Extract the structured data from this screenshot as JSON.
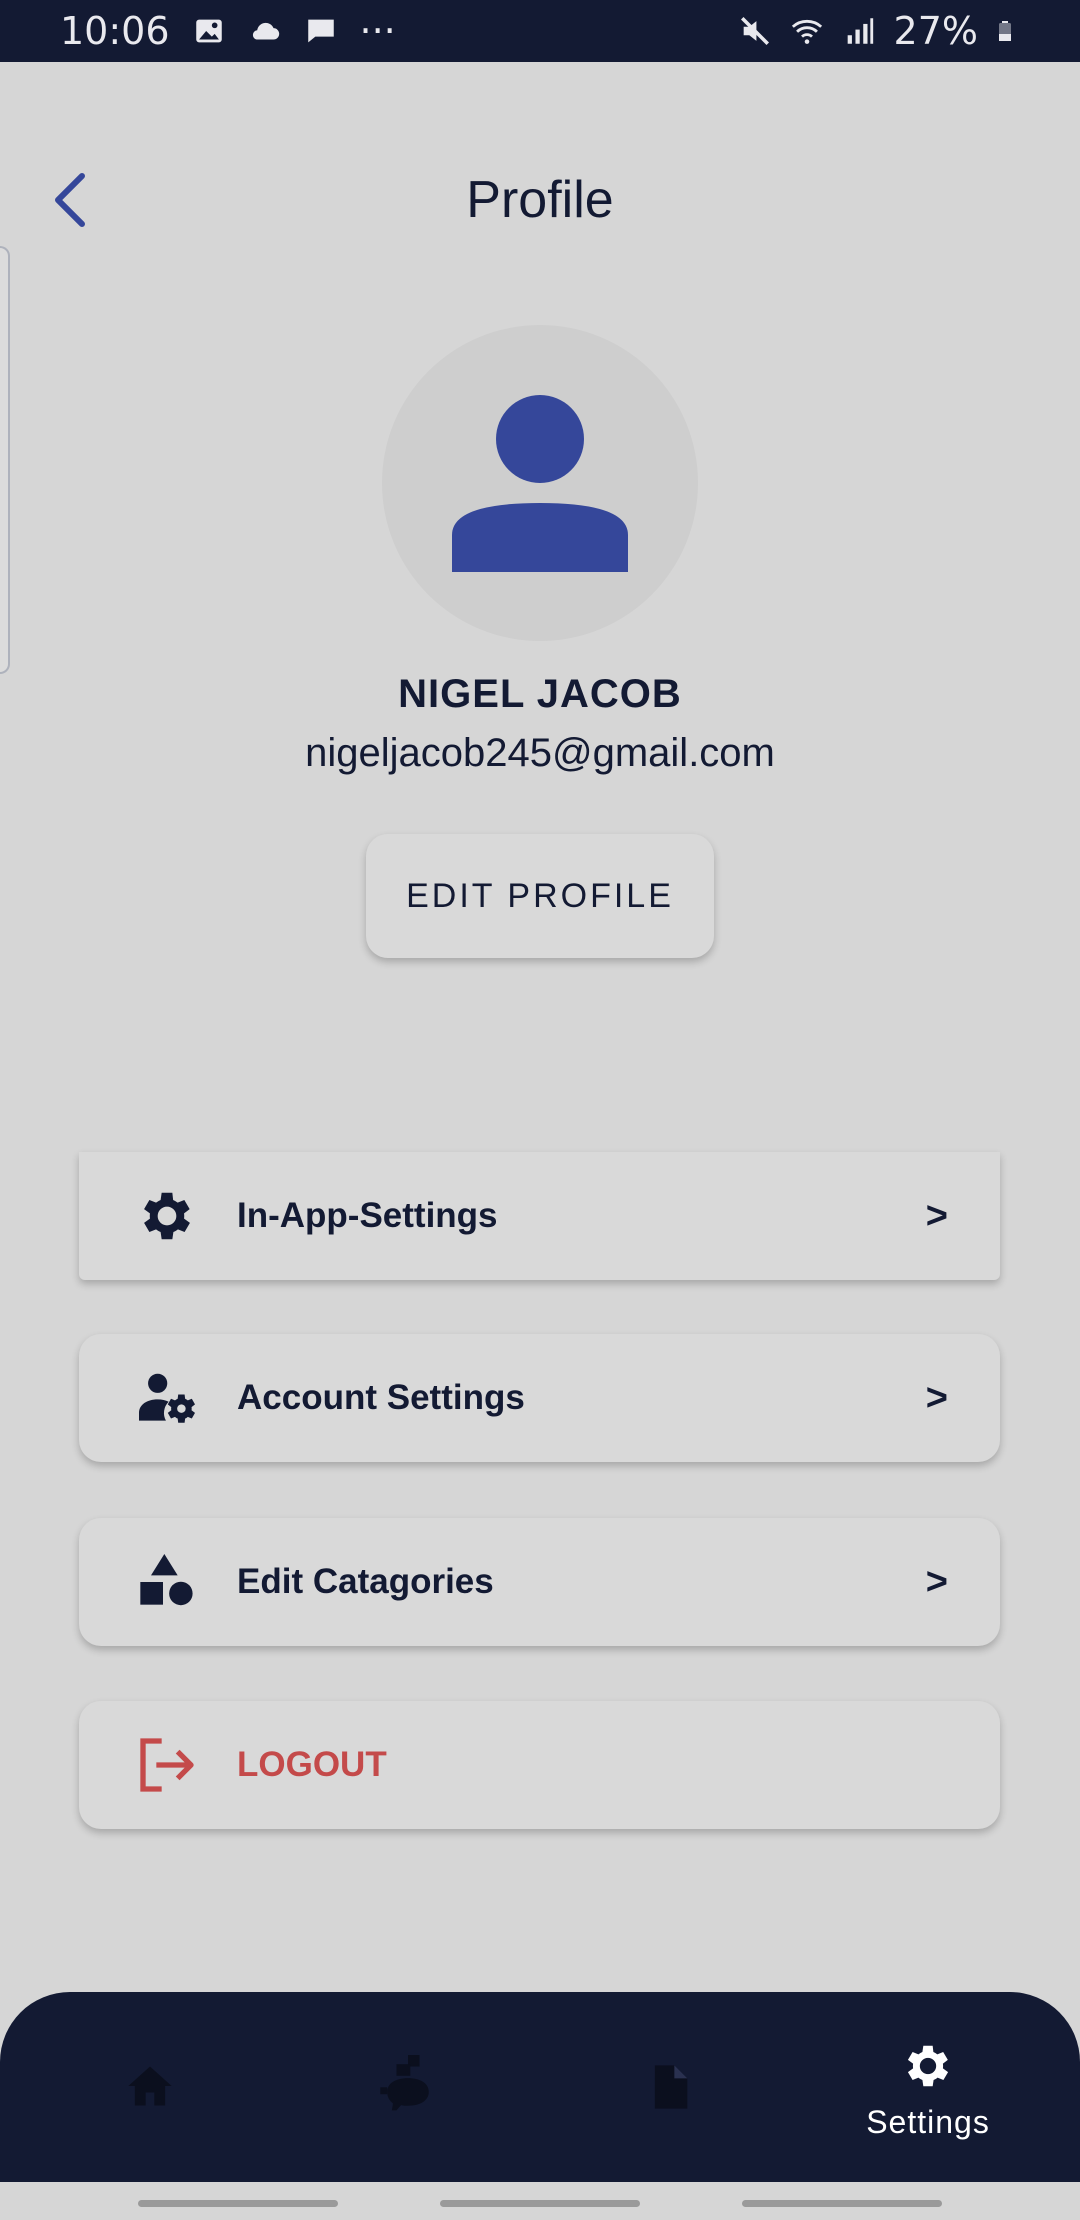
{
  "status_bar": {
    "time": "10:06",
    "battery": "27%",
    "more": "···"
  },
  "header": {
    "title": "Profile",
    "back_icon": "chevron-left-icon"
  },
  "profile": {
    "name": "NIGEL JACOB",
    "email": "nigeljacob245@gmail.com",
    "edit_button": "EDIT PROFILE"
  },
  "menu": {
    "items": [
      {
        "label": "In-App-Settings",
        "icon": "gear-icon",
        "chevron": ">"
      },
      {
        "label": "Account Settings",
        "icon": "user-gear-icon",
        "chevron": ">"
      },
      {
        "label": "Edit Catagories",
        "icon": "shapes-icon",
        "chevron": ">"
      }
    ],
    "logout": {
      "label": "LOGOUT",
      "icon": "logout-icon"
    }
  },
  "bottom_nav": {
    "items": [
      {
        "icon": "home-icon"
      },
      {
        "icon": "savings-icon"
      },
      {
        "icon": "document-icon"
      },
      {
        "icon": "gear-icon",
        "label": "Settings"
      }
    ]
  },
  "colors": {
    "navy": "#131a33",
    "accent_blue": "#35479a",
    "logout_red": "#c44a4a",
    "background": "#d6d6d6"
  }
}
